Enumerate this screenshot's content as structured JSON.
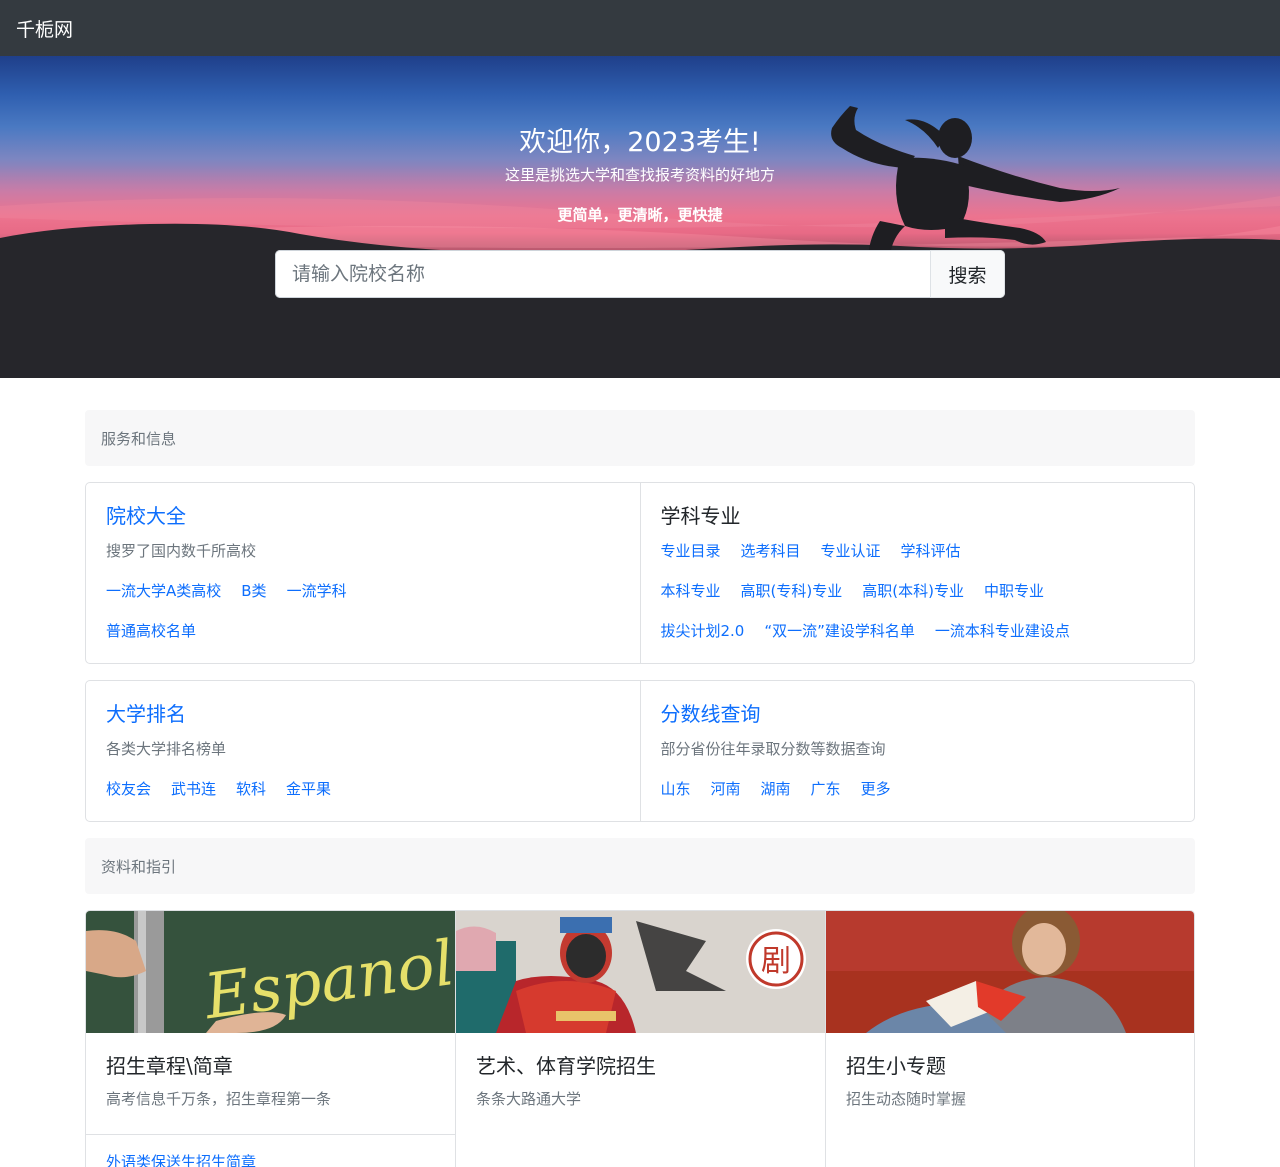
{
  "navbar": {
    "brand": "千栀网"
  },
  "hero": {
    "title": "欢迎你，2023考生!",
    "subtitle": "这里是挑选大学和查找报考资料的好地方",
    "tagline": "更简单，更清晰，更快捷",
    "search": {
      "placeholder": "请输入院校名称",
      "value": "",
      "button": "搜索"
    }
  },
  "services": {
    "header": "服务和信息",
    "row1": [
      {
        "title": "院校大全",
        "text": "搜罗了国内数千所高校",
        "links": [
          [
            "一流大学A类高校",
            "B类",
            "一流学科"
          ],
          [
            "普通高校名单"
          ]
        ]
      },
      {
        "title": "学科专业",
        "text": "",
        "links": [
          [
            "专业目录",
            "选考科目",
            "专业认证",
            "学科评估"
          ],
          [
            "本科专业",
            "高职(专科)专业",
            "高职(本科)专业",
            "中职专业"
          ],
          [
            "拔尖计划2.0",
            "“双一流”建设学科名单",
            "一流本科专业建设点"
          ]
        ]
      }
    ],
    "row2": [
      {
        "title": "大学排名",
        "text": "各类大学排名榜单",
        "links": [
          [
            "校友会",
            "武书连",
            "软科",
            "金平果"
          ]
        ]
      },
      {
        "title": "分数线查询",
        "text": "部分省份往年录取分数等数据查询",
        "links": [
          [
            "山东",
            "河南",
            "湖南",
            "广东",
            "更多"
          ]
        ]
      }
    ]
  },
  "guides": {
    "header": "资料和指引",
    "cards": [
      {
        "title": "招生章程\\简章",
        "text": "高考信息千万条，招生章程第一条",
        "footer_link": "外语类保送生招生简章"
      },
      {
        "title": "艺术、体育学院招生",
        "text": "条条大路通大学"
      },
      {
        "title": "招生小专题",
        "text": "招生动态随时掌握"
      }
    ],
    "image_text": {
      "chalkboard": "Espanol",
      "seal": "剧"
    }
  },
  "colors": {
    "navbar": "#343a40",
    "link": "#0d6efd",
    "muted": "#6c757d",
    "border": "#dfe1e4",
    "section_bg": "#f7f7f8"
  }
}
